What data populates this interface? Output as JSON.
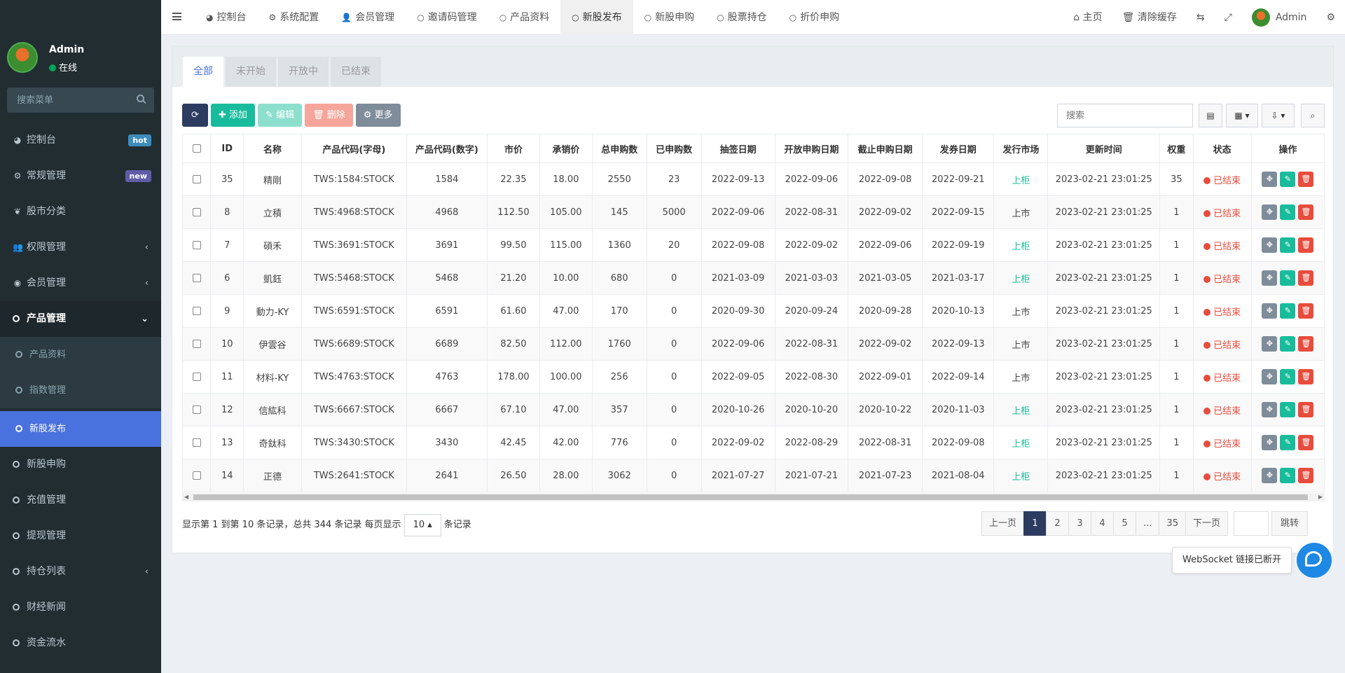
{
  "sidebar": {
    "user_name": "Admin",
    "user_status": "在线",
    "search_placeholder": "搜索菜单",
    "items": [
      {
        "label": "控制台",
        "icon": "dashboard-icon",
        "glyph": "◕",
        "badge": "hot"
      },
      {
        "label": "常规管理",
        "icon": "cogs-icon",
        "glyph": "⚙",
        "badge": "new"
      },
      {
        "label": "股市分类",
        "icon": "leaf-icon",
        "glyph": "❦"
      },
      {
        "label": "权限管理",
        "icon": "group-icon",
        "glyph": "👥",
        "chevron": "‹"
      },
      {
        "label": "会员管理",
        "icon": "user-circle-icon",
        "glyph": "◉",
        "chevron": "‹"
      },
      {
        "label": "产品管理",
        "icon": "circle-icon",
        "glyph": "○",
        "chevron": "⌄"
      }
    ],
    "sub_items": [
      {
        "label": "产品资料"
      },
      {
        "label": "指数管理"
      },
      {
        "label": "新股发布"
      }
    ],
    "items_after": [
      {
        "label": "新股申购"
      },
      {
        "label": "充值管理"
      },
      {
        "label": "提现管理"
      },
      {
        "label": "持仓列表",
        "chevron": "‹"
      },
      {
        "label": "财经新闻"
      },
      {
        "label": "资金流水"
      }
    ]
  },
  "topnav": {
    "tabs": [
      {
        "label": "控制台",
        "glyph": "◕"
      },
      {
        "label": "系统配置",
        "glyph": "⚙"
      },
      {
        "label": "会员管理",
        "glyph": "👤"
      },
      {
        "label": "邀请码管理",
        "glyph": "○"
      },
      {
        "label": "产品资料",
        "glyph": "○"
      },
      {
        "label": "新股发布",
        "glyph": "○"
      },
      {
        "label": "新股申购",
        "glyph": "○"
      },
      {
        "label": "股票持仓",
        "glyph": "○"
      },
      {
        "label": "折价申购",
        "glyph": "○"
      }
    ],
    "home": "主页",
    "clear_cache": "清除缓存",
    "admin": "Admin"
  },
  "panel": {
    "tabs": [
      "全部",
      "未开始",
      "开放中",
      "已结束"
    ],
    "toolbar": {
      "add": "添加",
      "edit": "编辑",
      "delete": "删除",
      "more": "更多"
    },
    "search_placeholder": "搜索"
  },
  "table": {
    "headers": [
      "ID",
      "名称",
      "产品代码(字母)",
      "产品代码(数字)",
      "市价",
      "承销价",
      "总申购数",
      "已申购数",
      "抽签日期",
      "开放申购日期",
      "截止申购日期",
      "发券日期",
      "发行市场",
      "更新时间",
      "权重",
      "状态",
      "操作"
    ],
    "rows": [
      [
        "35",
        "精剛",
        "TWS:1584:STOCK",
        "1584",
        "22.35",
        "18.00",
        "2550",
        "23",
        "2022-09-13",
        "2022-09-06",
        "2022-09-08",
        "2022-09-21",
        "上柜",
        "2023-02-21 23:01:25",
        "35",
        "已结束"
      ],
      [
        "8",
        "立積",
        "TWS:4968:STOCK",
        "4968",
        "112.50",
        "105.00",
        "145",
        "5000",
        "2022-09-06",
        "2022-08-31",
        "2022-09-02",
        "2022-09-15",
        "上市",
        "2023-02-21 23:01:25",
        "1",
        "已结束"
      ],
      [
        "7",
        "碩禾",
        "TWS:3691:STOCK",
        "3691",
        "99.50",
        "115.00",
        "1360",
        "20",
        "2022-09-08",
        "2022-09-02",
        "2022-09-06",
        "2022-09-19",
        "上柜",
        "2023-02-21 23:01:25",
        "1",
        "已结束"
      ],
      [
        "6",
        "凱鈺",
        "TWS:5468:STOCK",
        "5468",
        "21.20",
        "10.00",
        "680",
        "0",
        "2021-03-09",
        "2021-03-03",
        "2021-03-05",
        "2021-03-17",
        "上柜",
        "2023-02-21 23:01:25",
        "1",
        "已结束"
      ],
      [
        "9",
        "動力-KY",
        "TWS:6591:STOCK",
        "6591",
        "61.60",
        "47.00",
        "170",
        "0",
        "2020-09-30",
        "2020-09-24",
        "2020-09-28",
        "2020-10-13",
        "上市",
        "2023-02-21 23:01:25",
        "1",
        "已结束"
      ],
      [
        "10",
        "伊雲谷",
        "TWS:6689:STOCK",
        "6689",
        "82.50",
        "112.00",
        "1760",
        "0",
        "2022-09-06",
        "2022-08-31",
        "2022-09-02",
        "2022-09-13",
        "上市",
        "2023-02-21 23:01:25",
        "1",
        "已结束"
      ],
      [
        "11",
        "材料-KY",
        "TWS:4763:STOCK",
        "4763",
        "178.00",
        "100.00",
        "256",
        "0",
        "2022-09-05",
        "2022-08-30",
        "2022-09-01",
        "2022-09-14",
        "上市",
        "2023-02-21 23:01:25",
        "1",
        "已结束"
      ],
      [
        "12",
        "信紘科",
        "TWS:6667:STOCK",
        "6667",
        "67.10",
        "47.00",
        "357",
        "0",
        "2020-10-26",
        "2020-10-20",
        "2020-10-22",
        "2020-11-03",
        "上柜",
        "2023-02-21 23:01:25",
        "1",
        "已结束"
      ],
      [
        "13",
        "奇鈦科",
        "TWS:3430:STOCK",
        "3430",
        "42.45",
        "42.00",
        "776",
        "0",
        "2022-09-02",
        "2022-08-29",
        "2022-08-31",
        "2022-09-08",
        "上柜",
        "2023-02-21 23:01:25",
        "1",
        "已结束"
      ],
      [
        "14",
        "正德",
        "TWS:2641:STOCK",
        "2641",
        "26.50",
        "28.00",
        "3062",
        "0",
        "2021-07-27",
        "2021-07-21",
        "2021-07-23",
        "2021-08-04",
        "上柜",
        "2023-02-21 23:01:25",
        "1",
        "已结束"
      ]
    ]
  },
  "pagination": {
    "info_prefix": "显示第 1 到第 10 条记录，总共 344 条记录 每页显示",
    "page_size": "10",
    "info_suffix": "条记录",
    "prev": "上一页",
    "pages": [
      "1",
      "2",
      "3",
      "4",
      "5",
      "...",
      "35"
    ],
    "next": "下一页",
    "go": "跳转"
  },
  "websocket_message": "WebSocket 链接已断开",
  "colors": {
    "sidebar_bg": "#222d32",
    "active_blue": "#4a72de",
    "success": "#18bc9c",
    "danger": "#e74c3c",
    "dark_btn": "#2c3b60"
  }
}
